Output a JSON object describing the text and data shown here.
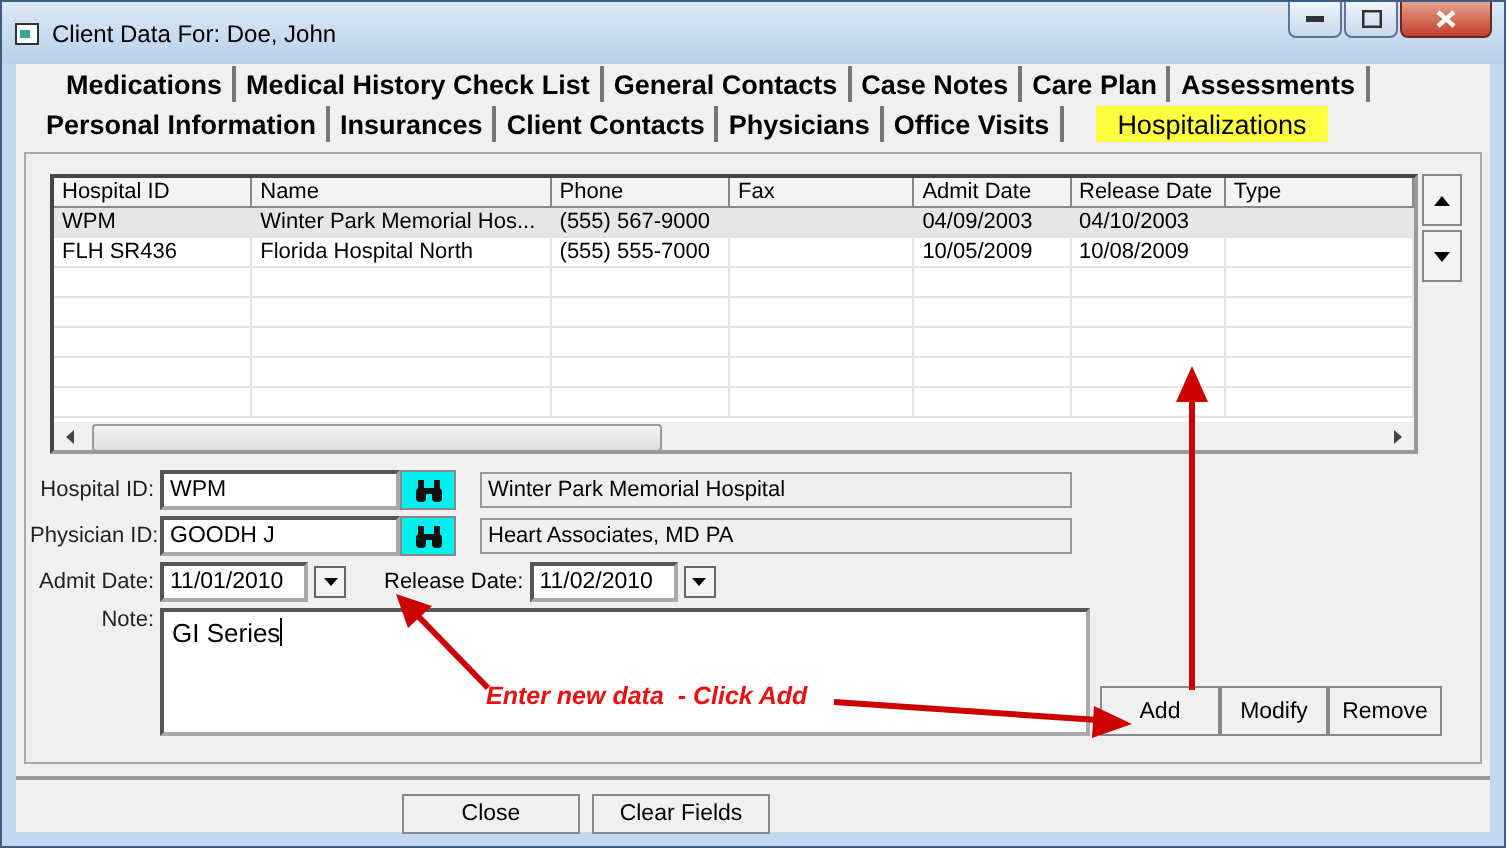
{
  "window": {
    "title": "Client Data For: Doe, John"
  },
  "tab_rows": [
    [
      {
        "label": "Medications",
        "selected": false
      },
      {
        "label": "Medical History Check List",
        "selected": false
      },
      {
        "label": "General Contacts",
        "selected": false
      },
      {
        "label": "Case Notes",
        "selected": false
      },
      {
        "label": "Care Plan",
        "selected": false
      },
      {
        "label": "Assessments",
        "selected": false
      }
    ],
    [
      {
        "label": "Personal Information",
        "selected": false
      },
      {
        "label": "Insurances",
        "selected": false
      },
      {
        "label": "Client Contacts",
        "selected": false
      },
      {
        "label": "Physicians",
        "selected": false
      },
      {
        "label": "Office Visits",
        "selected": false
      },
      {
        "label": "Hospitalizations",
        "selected": true
      }
    ]
  ],
  "table": {
    "columns": [
      "Hospital ID",
      "Name",
      "Phone",
      "Fax",
      "Admit Date",
      "Release Date",
      "Type"
    ],
    "rows": [
      {
        "cells": [
          "WPM",
          "Winter Park Memorial Hos...",
          "(555) 567-9000",
          "",
          "04/09/2003",
          "04/10/2003",
          ""
        ],
        "selected": true
      },
      {
        "cells": [
          "FLH SR436",
          "Florida Hospital North",
          "(555) 555-7000",
          "",
          "10/05/2009",
          "10/08/2009",
          ""
        ],
        "selected": false
      }
    ]
  },
  "form": {
    "hospital_id": {
      "label": "Hospital ID:",
      "value": "WPM",
      "description": "Winter Park Memorial Hospital"
    },
    "physician_id": {
      "label": "Physician ID:",
      "value": "GOODH J",
      "description": "Heart Associates, MD PA"
    },
    "admit_date": {
      "label": "Admit Date:",
      "value": "11/01/2010"
    },
    "release_date": {
      "label": "Release Date:",
      "value": "11/02/2010"
    },
    "note": {
      "label": "Note:",
      "value": "GI Series"
    }
  },
  "actions": [
    "Add",
    "Modify",
    "Remove"
  ],
  "annotation": {
    "text": "Enter new data  - Click Add"
  },
  "footer_buttons": [
    "Close",
    "Clear Fields"
  ]
}
